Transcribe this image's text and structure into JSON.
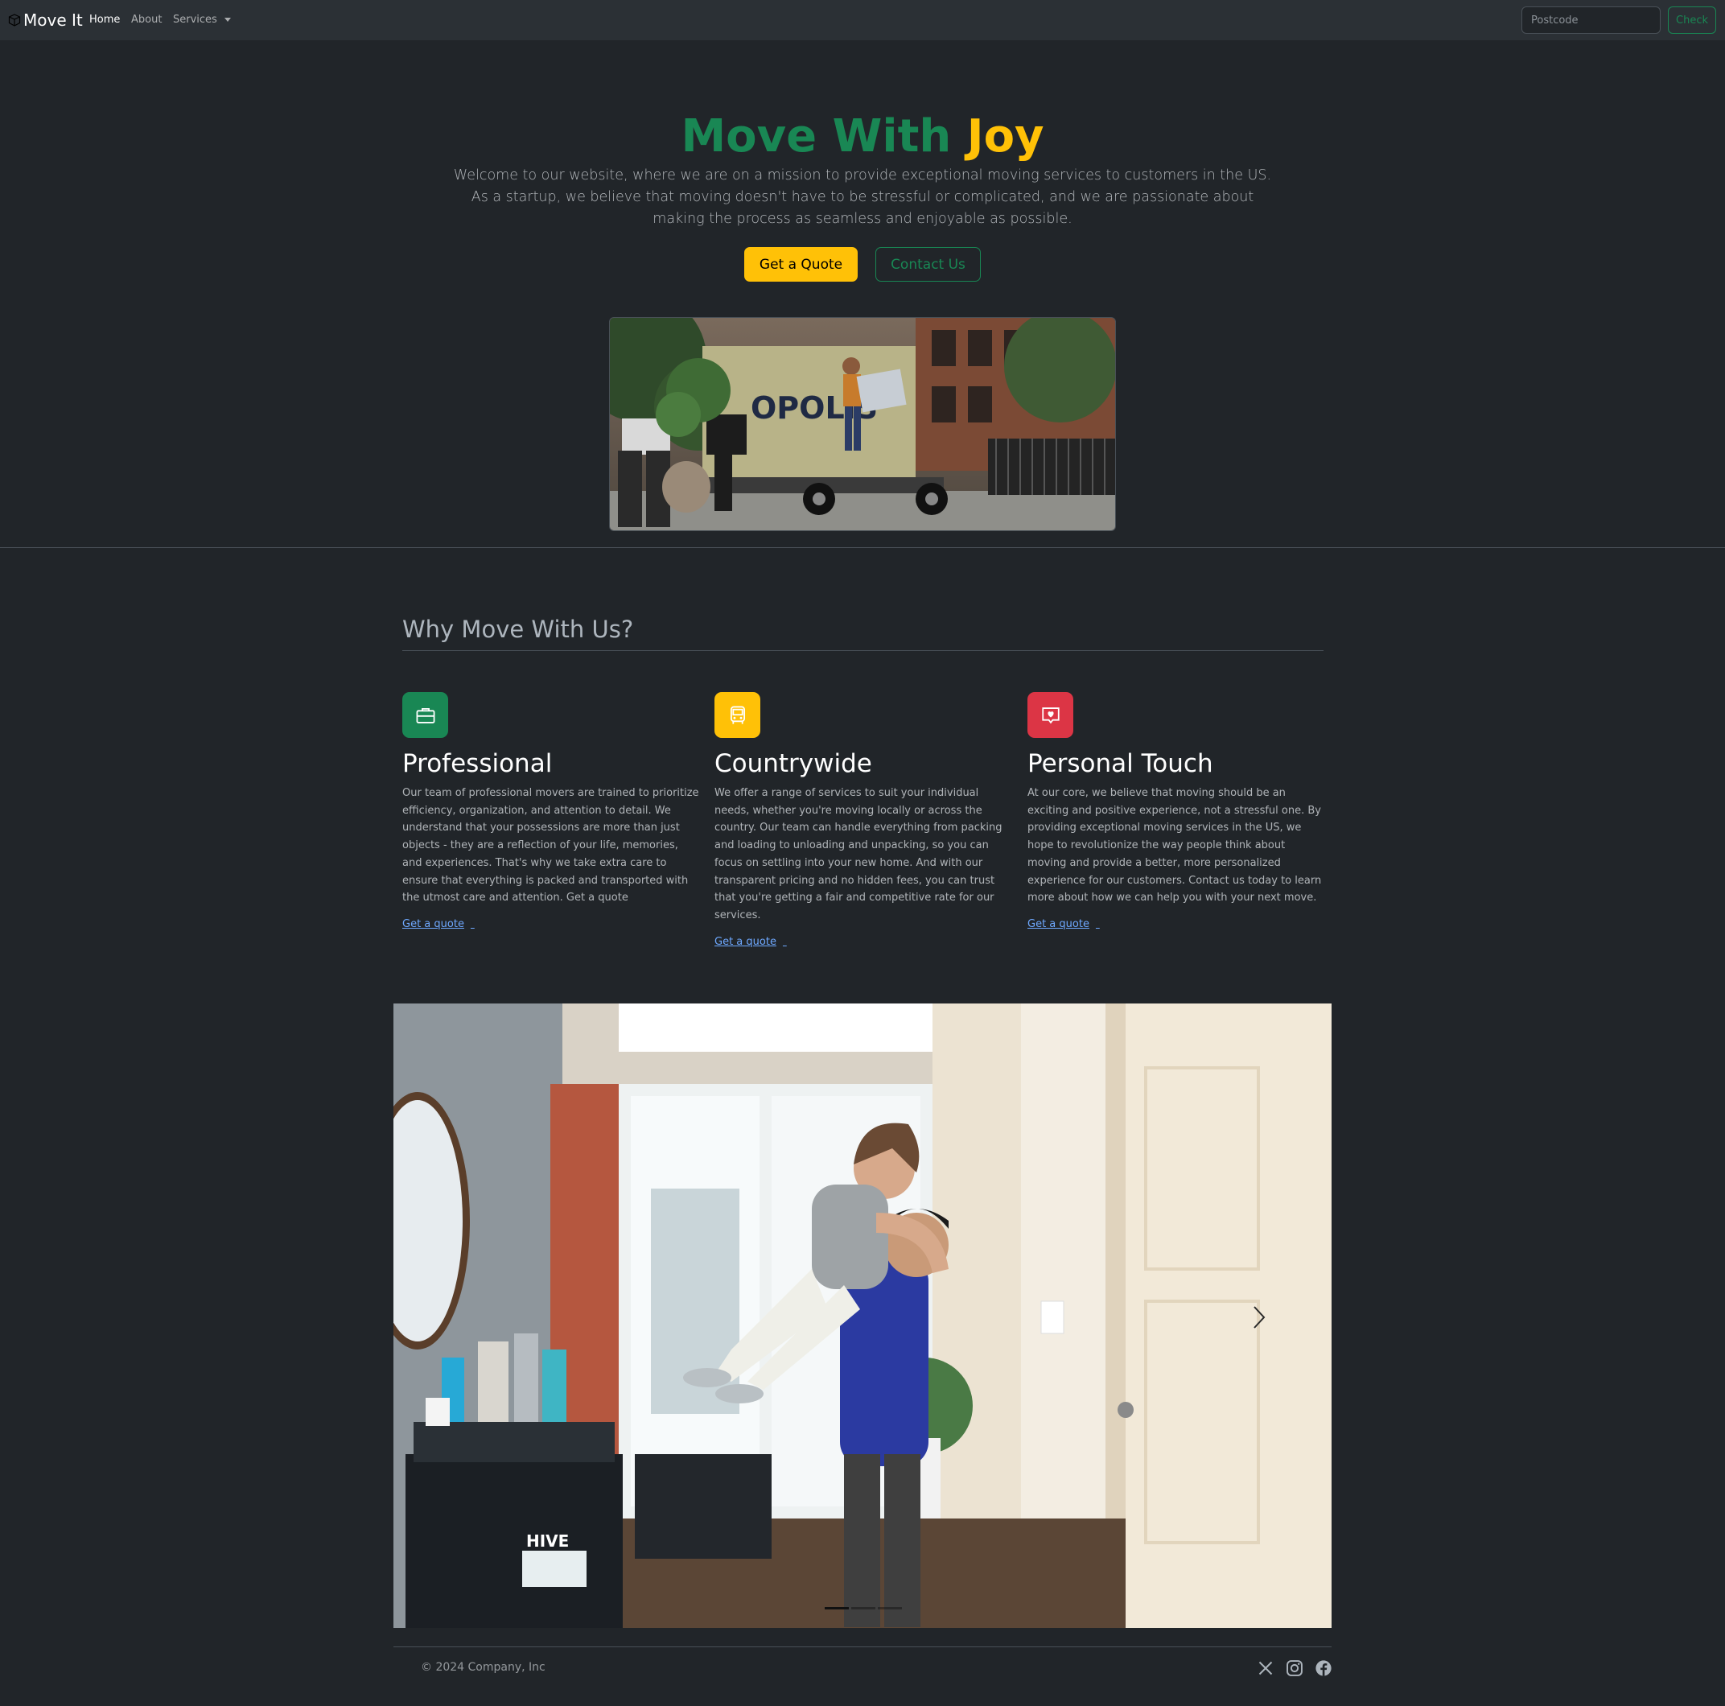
{
  "navbar": {
    "brand": "Move It",
    "links": [
      {
        "label": "Home",
        "active": true
      },
      {
        "label": "About",
        "active": false
      },
      {
        "label": "Services",
        "active": false
      }
    ],
    "search": {
      "placeholder": "Postcode",
      "value": ""
    },
    "check_label": "Check"
  },
  "hero": {
    "title_part1": "Move With",
    "title_part2": "Joy",
    "lead": "Welcome to our website, where we are on a mission to provide exceptional moving services to customers in the US. As a startup, we believe that moving doesn't have to be stressful or complicated, and we are passionate about making the process as seamless and enjoyable as possible.",
    "primary_button": "Get a Quote",
    "secondary_button": "Contact Us",
    "image_alt": "Movers loading a moving truck"
  },
  "features": {
    "title": "Why Move With Us?",
    "items": [
      {
        "title": "Professional",
        "icon": "briefcase-icon",
        "color": "#198754",
        "text": "Our team of professional movers are trained to prioritize efficiency, organization, and attention to detail. We understand that your possessions are more than just objects - they are a reflection of your life, memories, and experiences. That's why we take extra care to ensure that everything is packed and transported with the utmost care and attention. Get a quote",
        "link": "Get a quote"
      },
      {
        "title": "Countrywide",
        "icon": "bus-icon",
        "color": "#ffc107",
        "text": "We offer a range of services to suit your individual needs, whether you're moving locally or across the country. Our team can handle everything from packing and loading to unloading and unpacking, so you can focus on settling into your new home. And with our transparent pricing and no hidden fees, you can trust that you're getting a fair and competitive rate for our services.",
        "link": "Get a quote"
      },
      {
        "title": "Personal Touch",
        "icon": "chat-heart-icon",
        "color": "#dc3545",
        "text": "At our core, we believe that moving should be an exciting and positive experience, not a stressful one. By providing exceptional moving services in the US, we hope to revolutionize the way people think about moving and provide a better, more personalized experience for our customers. Contact us today to learn more about how we can help you with your next move.",
        "link": "Get a quote"
      }
    ]
  },
  "carousel": {
    "slides": 3,
    "active_slide": 1,
    "image_alt": "Couple hugging in their new home"
  },
  "footer": {
    "copyright": "© 2024 Company, Inc",
    "social": [
      "x-icon",
      "instagram-icon",
      "facebook-icon"
    ]
  }
}
